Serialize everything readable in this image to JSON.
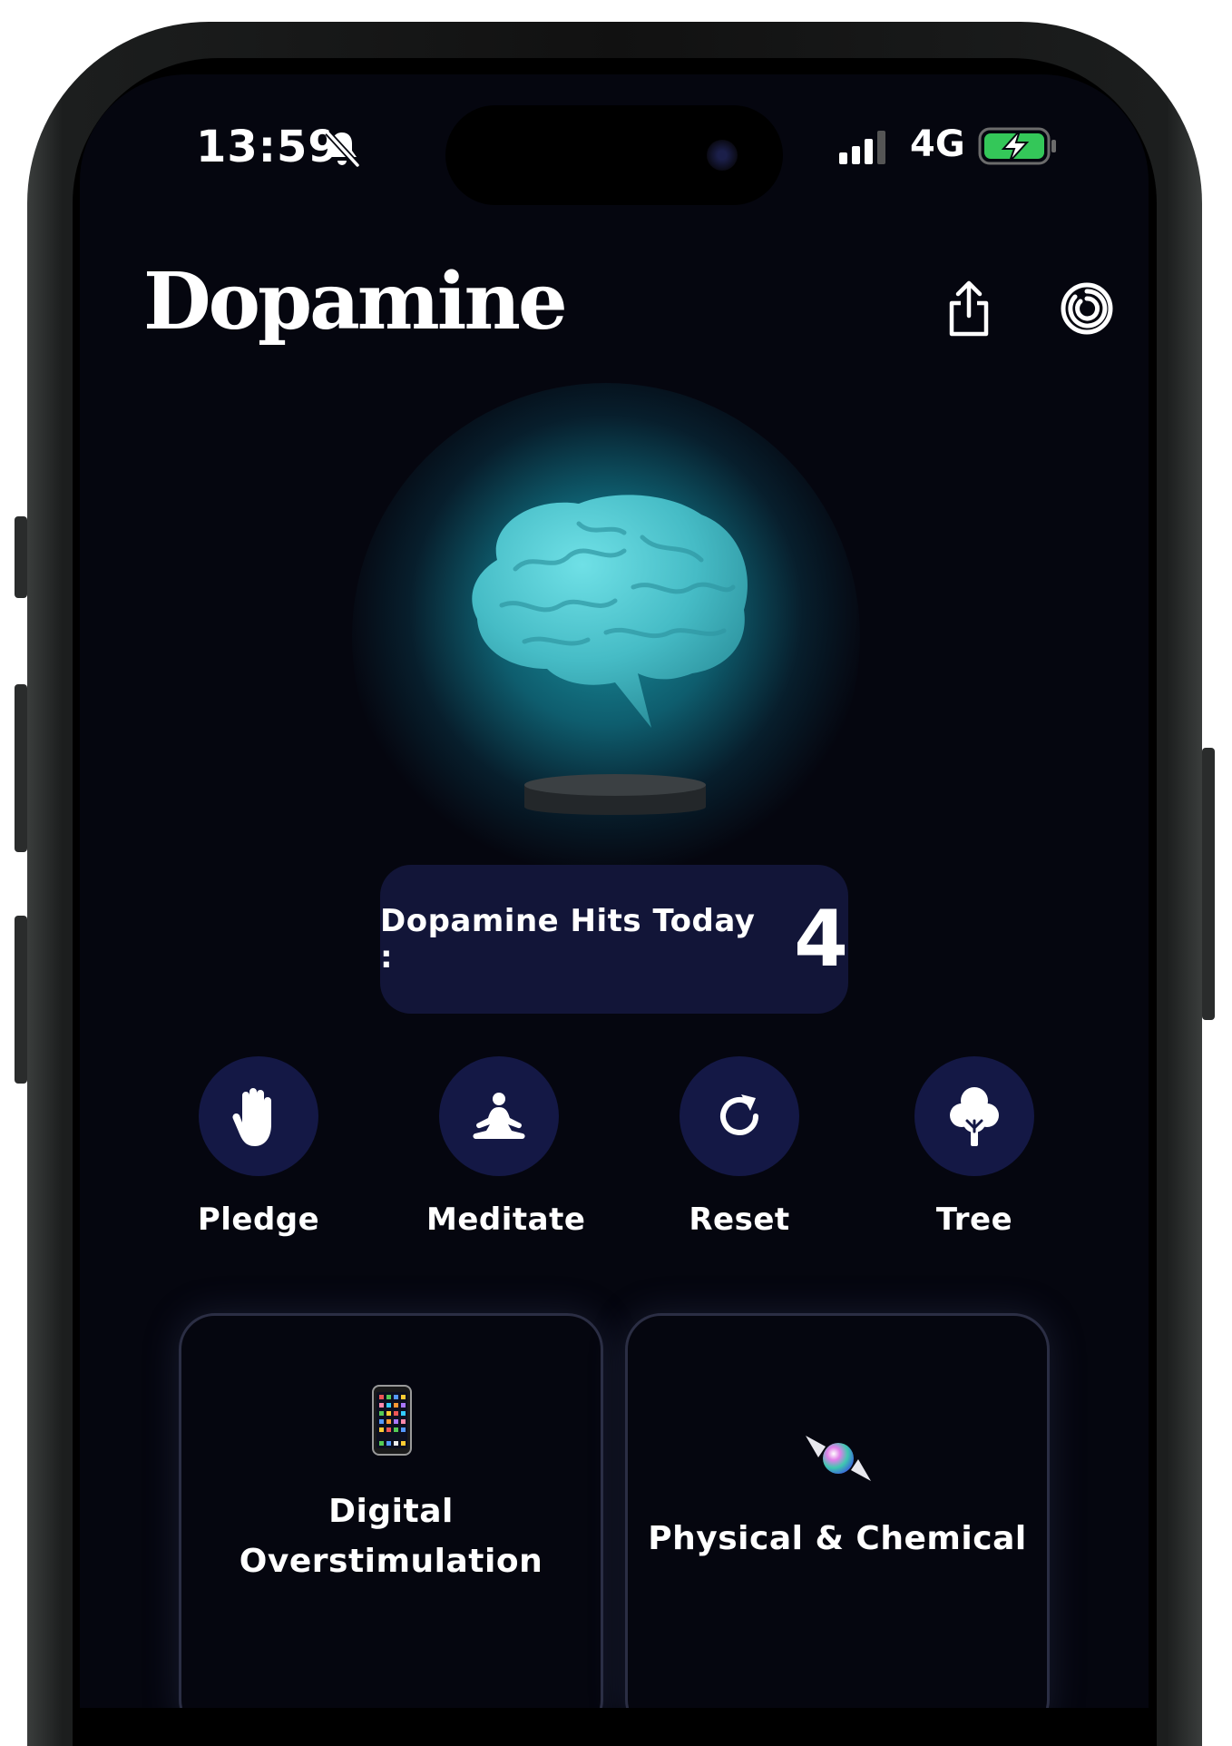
{
  "status_bar": {
    "time": "13:59",
    "network": "4G",
    "icons": [
      "bell-slash-icon",
      "signal-icon",
      "battery-charging-icon"
    ]
  },
  "header": {
    "title": "Dopamine",
    "share_icon": "share-icon",
    "power_icon": "power-icon"
  },
  "hits": {
    "label": "Dopamine Hits Today :",
    "value": "4"
  },
  "actions": [
    {
      "label": "Pledge",
      "icon": "hand-icon"
    },
    {
      "label": "Meditate",
      "icon": "meditate-icon"
    },
    {
      "label": "Reset",
      "icon": "reset-icon"
    },
    {
      "label": "Tree",
      "icon": "tree-icon"
    }
  ],
  "categories": [
    {
      "line1": "Digital",
      "line2": "Overstimulation",
      "icon": "phone-icon"
    },
    {
      "line1": "Physical & Chemical",
      "icon": "candy-icon"
    }
  ],
  "colors": {
    "background": "#05060f",
    "panel": "#121538",
    "action_circle": "#141845",
    "glow": "#1eaab9",
    "brain": "#4fc7cf",
    "battery": "#34c759"
  }
}
